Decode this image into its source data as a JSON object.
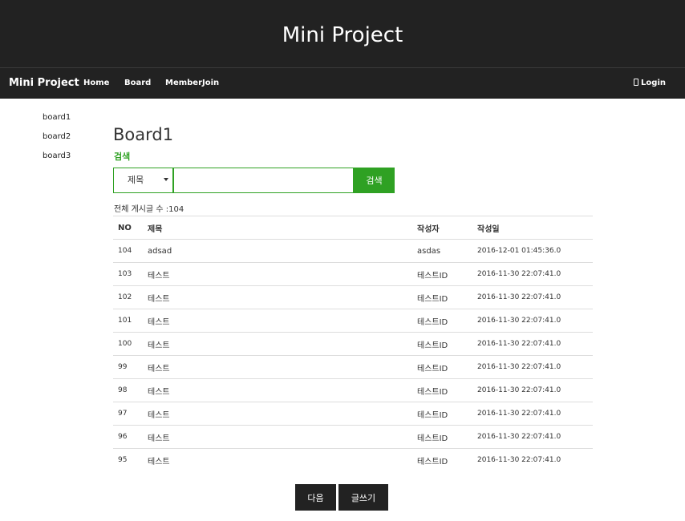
{
  "header": {
    "title": "Mini Project"
  },
  "navbar": {
    "brand": "Mini Project",
    "links": [
      "Home",
      "Board",
      "MemberJoin"
    ],
    "login": "Login"
  },
  "sidebar": {
    "items": [
      "board1",
      "board2",
      "board3"
    ]
  },
  "main": {
    "title": "Board1",
    "search_label": "검색",
    "search_select": "제목",
    "search_value": "",
    "search_button": "검색",
    "total_label": "전체 게시글 수 :104",
    "columns": [
      "NO",
      "제목",
      "작성자",
      "작성일"
    ],
    "rows": [
      [
        "104",
        "adsad",
        "asdas",
        "2016-12-01 01:45:36.0"
      ],
      [
        "103",
        "테스트",
        "테스트ID",
        "2016-11-30 22:07:41.0"
      ],
      [
        "102",
        "테스트",
        "테스트ID",
        "2016-11-30 22:07:41.0"
      ],
      [
        "101",
        "테스트",
        "테스트ID",
        "2016-11-30 22:07:41.0"
      ],
      [
        "100",
        "테스트",
        "테스트ID",
        "2016-11-30 22:07:41.0"
      ],
      [
        "99",
        "테스트",
        "테스트ID",
        "2016-11-30 22:07:41.0"
      ],
      [
        "98",
        "테스트",
        "테스트ID",
        "2016-11-30 22:07:41.0"
      ],
      [
        "97",
        "테스트",
        "테스트ID",
        "2016-11-30 22:07:41.0"
      ],
      [
        "96",
        "테스트",
        "테스트ID",
        "2016-11-30 22:07:41.0"
      ],
      [
        "95",
        "테스트",
        "테스트ID",
        "2016-11-30 22:07:41.0"
      ]
    ],
    "next_button": "다음",
    "write_button": "글쓰기"
  },
  "colors": {
    "dark": "#222222",
    "accent": "#2fa123",
    "border": "#dddddd"
  },
  "icons": {
    "login": "user-icon"
  }
}
